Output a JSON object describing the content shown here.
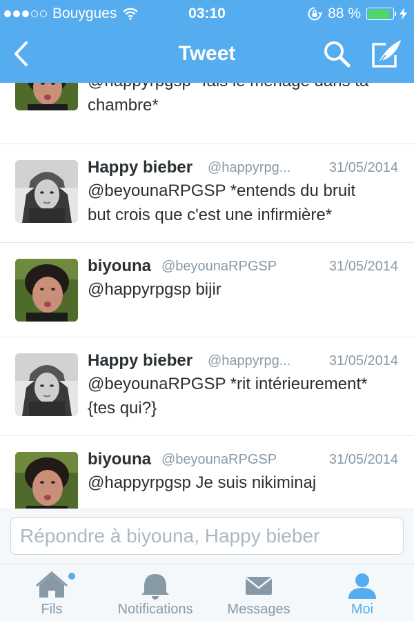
{
  "status_bar": {
    "carrier": "Bouygues",
    "time": "03:10",
    "battery_percent": "88 %",
    "battery_level": 0.88
  },
  "nav": {
    "title": "Tweet"
  },
  "tweets": [
    {
      "name": "",
      "handle": "",
      "date": "",
      "line1": "@happyrpgsp *fais le ménage dans ta",
      "line2": "chambre*"
    },
    {
      "name": "Happy bieber",
      "handle": "@happyrpg...",
      "date": "31/05/2014",
      "line1": "@beyounaRPGSP *entends du bruit",
      "line2": "but crois que c'est une infirmière*"
    },
    {
      "name": "biyouna",
      "handle": "@beyounaRPGSP",
      "date": "31/05/2014",
      "line1": "@happyrpgsp bijir",
      "line2": ""
    },
    {
      "name": "Happy bieber",
      "handle": "@happyrpg...",
      "date": "31/05/2014",
      "line1": "@beyounaRPGSP *rit intérieurement*",
      "line2": "{tes qui?}"
    },
    {
      "name": "biyouna",
      "handle": "@beyounaRPGSP",
      "date": "31/05/2014",
      "line1": "@happyrpgsp Je suis nikiminaj",
      "line2": ""
    }
  ],
  "reply": {
    "placeholder": "Répondre à biyouna, Happy bieber",
    "value": ""
  },
  "tabs": [
    {
      "label": "Fils",
      "icon": "home-icon"
    },
    {
      "label": "Notifications",
      "icon": "bell-icon"
    },
    {
      "label": "Messages",
      "icon": "envelope-icon"
    },
    {
      "label": "Moi",
      "icon": "person-icon"
    }
  ],
  "colors": {
    "header": "#55acee",
    "accent": "#55acee",
    "battery": "#4cd964",
    "muted": "#8899a6",
    "text": "#292f33"
  }
}
